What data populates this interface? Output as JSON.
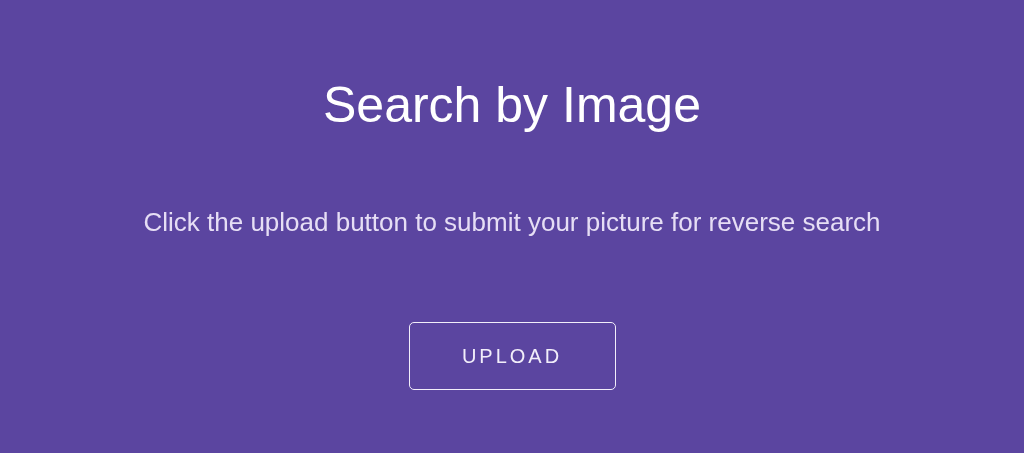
{
  "title": "Search by Image",
  "instructions": "Click the upload button to submit your picture for reverse search",
  "upload_button": "UPLOAD"
}
